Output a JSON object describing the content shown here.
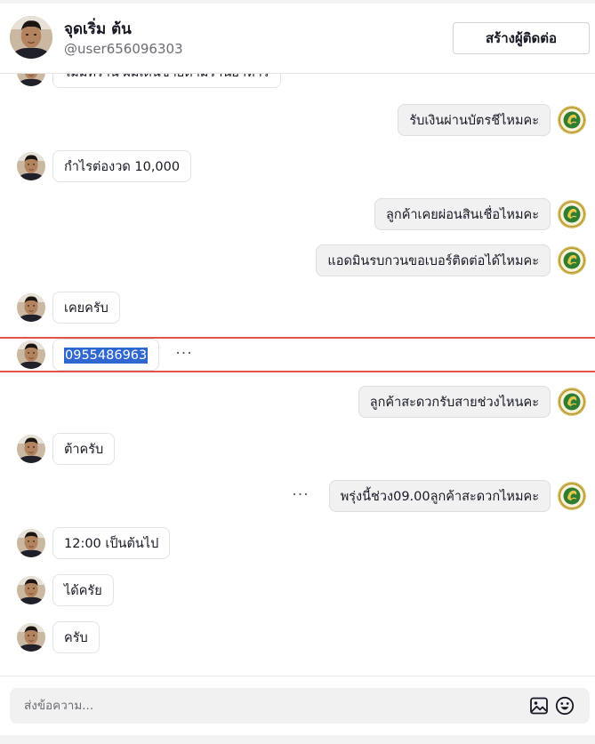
{
  "header": {
    "name": "จุดเริ่ม ต้น",
    "handle": "@user656096303",
    "create_button": "สร้างผู้ติดต่อ"
  },
  "messages": [
    {
      "side": "in",
      "text": "ไม่มีที่ร้าน ผมเดินขายตามร้านอาหาร",
      "partial": true
    },
    {
      "side": "out",
      "text": "รับเงินผ่านบัตรชีไหมคะ"
    },
    {
      "side": "in",
      "text": "กำไรต่องวด 10,000"
    },
    {
      "side": "out",
      "text": "ลูกค้าเคยผ่อนสินเชื่อไหมคะ"
    },
    {
      "side": "out",
      "text": "แอดมินรบกวนขอเบอร์ติดต่อได้ไหมคะ"
    },
    {
      "side": "in",
      "text": "เคยครับ"
    },
    {
      "side": "in",
      "text": "0955486963",
      "selected": true,
      "highlighted": true
    },
    {
      "side": "out",
      "text": "ลูกค้าสะดวกรับสายช่วงไหนคะ"
    },
    {
      "side": "in",
      "text": "ต้าครับ"
    },
    {
      "side": "out",
      "text": "พรุ่งนี้ช่วง09.00ลูกค้าสะดวกไหมคะ"
    },
    {
      "side": "in",
      "text": "12:00 เป็นต้นไป"
    },
    {
      "side": "in",
      "text": "ได้ครัย"
    },
    {
      "side": "in",
      "text": "ครับ"
    }
  ],
  "more_label": "···",
  "composer": {
    "placeholder": "ส่งข้อความ..."
  },
  "icons": {
    "image": "image-icon",
    "emoji": "emoji-icon",
    "more": "more-options-icon"
  },
  "colors": {
    "highlight_border": "#e0524a",
    "selection": "#2f66cf",
    "outgoing_bubble": "#f1f1f2",
    "logo_gold": "#c9a227",
    "logo_green": "#2e7d32"
  }
}
